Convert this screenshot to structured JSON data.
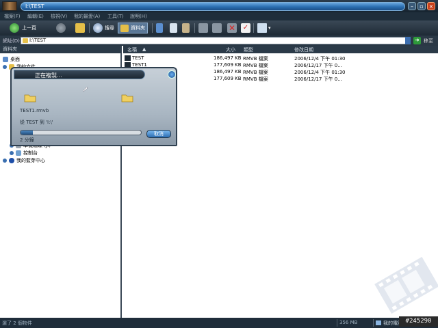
{
  "titlebar": {
    "title": "I:\\TEST"
  },
  "menubar": {
    "items": [
      "檔案(F)",
      "編輯(E)",
      "檢視(V)",
      "我的最愛(A)",
      "工具(T)",
      "說明(H)"
    ]
  },
  "toolbar": {
    "back": "上一頁",
    "search": "搜尋",
    "folders": "資料夾"
  },
  "address": {
    "label": "網址(D)",
    "value": "I:\\TEST",
    "go": "移至"
  },
  "leftpane": {
    "header": "資料夾",
    "items": [
      {
        "label": "桌面"
      },
      {
        "label": "我的文件"
      },
      {
        "label": "本機磁碟 (J:)"
      },
      {
        "label": "控制台"
      },
      {
        "label": "我的藍芽中心"
      }
    ]
  },
  "list": {
    "columns": {
      "name": "名稱",
      "size": "大小",
      "type": "類型",
      "date": "修改日期"
    },
    "rows": [
      {
        "name": "TEST",
        "size": "186,497 KB",
        "type": "RMVB 檔案",
        "date": "2006/12/4 下午 01:30"
      },
      {
        "name": "TEST1",
        "size": "177,609 KB",
        "type": "RMVB 檔案",
        "date": "2006/12/17 下午 0..."
      },
      {
        "name": "",
        "size": "186,497 KB",
        "type": "RMVB 檔案",
        "date": "2006/12/4 下午 01:30"
      },
      {
        "name": "",
        "size": "177,609 KB",
        "type": "RMVB 檔案",
        "date": "2006/12/17 下午 0..."
      }
    ]
  },
  "dialog": {
    "title": "正在複製...",
    "file": "TEST1.rmvb",
    "from_to": "從 TEST 到 'I:\\'",
    "progress": 0.1,
    "cancel": "取消",
    "remaining": "2 分鐘"
  },
  "status": {
    "left": "選了 2 個物件",
    "size": "356 MB",
    "computer": "我的電腦"
  },
  "badge": "#245290",
  "colors": {
    "titlebar": "#2b6eb0",
    "dark": "#1f2d3a",
    "accent": "#2e9a3a"
  }
}
